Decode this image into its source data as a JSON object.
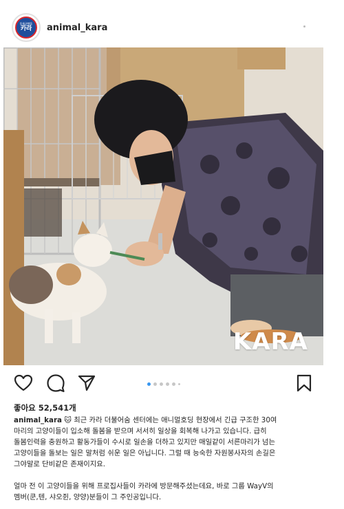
{
  "header": {
    "avatar_small_text": "동물권행동",
    "avatar_big_text": "카라",
    "username": "animal_kara"
  },
  "photo": {
    "watermark": "KARA"
  },
  "actions": {
    "icons": [
      "heart-icon",
      "comment-icon",
      "share-icon",
      "bookmark-icon"
    ],
    "carousel_count": 6,
    "carousel_active_index": 0
  },
  "post": {
    "likes": "좋아요 52,541개",
    "caption_username": "animal_kara",
    "caption_emoji": "🐱",
    "caption_lines": [
      "최근 카라 더불어숨 센터에는 애니멀호딩 현장에서 긴급 구조한 30여",
      "마리의 고양이들이 입소해 돌봄을 받으며 서서히 일상을 회복해 나가고 있습니다. 급히",
      "돌봄인력을 충원하고 활동가들이 수시로 일손을 더하고 있지만 매일같이 서른마리가 넘는",
      "고양이들을 돌보는 일은 말처럼 쉬운 일은 아닙니다. 그럴 때 능숙한 자원봉사자의 손길은",
      "그야말로 단비같은 존재이지요.",
      "",
      "얼마 전 이 고양이들을 위해 프로집사들이 카라에 방문해주셨는데요, 바로 그룹 WayV의",
      "멤버(쿤,텐, 샤오쥔, 양양)분들이 그 주인공입니다."
    ]
  },
  "colors": {
    "accent": "#3897f0",
    "text": "#262626",
    "kara_blue": "#1f4e9c",
    "kara_red": "#d8262d"
  }
}
